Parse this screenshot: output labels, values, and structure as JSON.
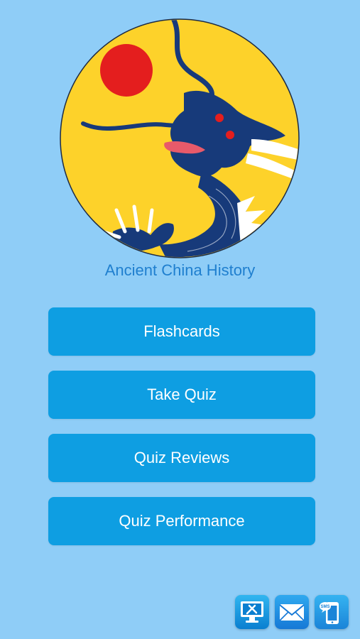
{
  "app": {
    "title": "Ancient China History"
  },
  "menu": {
    "items": [
      {
        "label": "Flashcards"
      },
      {
        "label": "Take Quiz"
      },
      {
        "label": "Quiz Reviews"
      },
      {
        "label": "Quiz Performance"
      }
    ]
  },
  "footer": {
    "icons": [
      {
        "name": "computer-tools-icon"
      },
      {
        "name": "email-icon"
      },
      {
        "name": "sms-icon",
        "label": "SMS"
      }
    ]
  },
  "colors": {
    "background": "#8fcdf7",
    "title": "#1f7fcf",
    "button": "#0e9ee2",
    "button_text": "#ffffff",
    "logo_yellow": "#fdd22a",
    "logo_sun": "#e41e1e",
    "logo_dragon": "#173a7a"
  }
}
